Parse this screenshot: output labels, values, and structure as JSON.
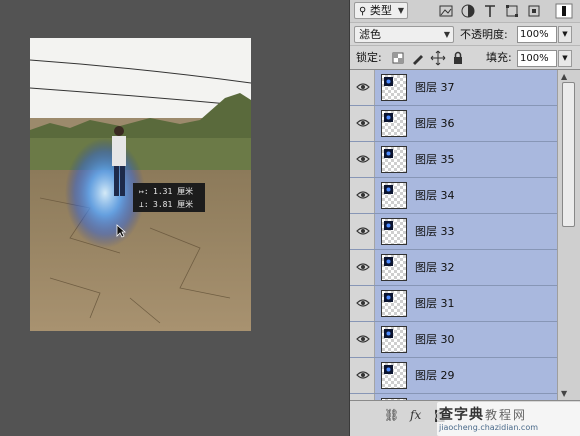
{
  "measure_tooltip": {
    "row1_symbol": "↦:",
    "row1_value": "1.31 厘米",
    "row2_symbol": "⊥:",
    "row2_value": "3.81 厘米"
  },
  "layers_panel": {
    "filter_kind": "类型",
    "blend_mode": "滤色",
    "opacity_label": "不透明度:",
    "opacity_value": "100%",
    "lock_label": "锁定:",
    "fill_label": "填充:",
    "fill_value": "100%",
    "layers": [
      {
        "name": "图层 37"
      },
      {
        "name": "图层 36"
      },
      {
        "name": "图层 35"
      },
      {
        "name": "图层 34"
      },
      {
        "name": "图层 33"
      },
      {
        "name": "图层 32"
      },
      {
        "name": "图层 31"
      },
      {
        "name": "图层 30"
      },
      {
        "name": "图层 29"
      },
      {
        "name": ""
      }
    ],
    "selection_color": "#a9b8de",
    "bottom_icons": [
      "link-icon",
      "fx-icon",
      "mask-icon"
    ]
  },
  "watermark": {
    "logo_text": "查字典",
    "subtitle": "教程网",
    "url": "jiaocheng.chazidian.com"
  }
}
